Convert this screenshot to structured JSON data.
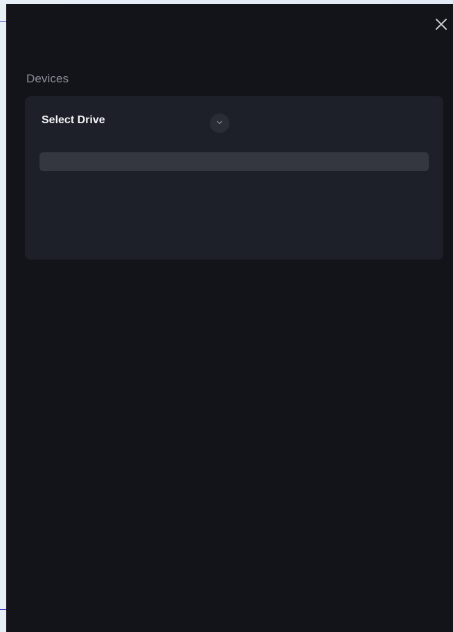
{
  "panel": {
    "close_icon": "close-icon",
    "section_title": "Devices"
  },
  "drive_selector": {
    "label": "Select Drive",
    "toggle_icon": "chevron-down-icon",
    "selected_value": "",
    "progress": 0
  },
  "colors": {
    "panel_background": "#13141a",
    "card_background": "#1e2029",
    "bar_background": "#343640",
    "title_text": "#8b8e98",
    "label_text": "#f2f3f6"
  }
}
